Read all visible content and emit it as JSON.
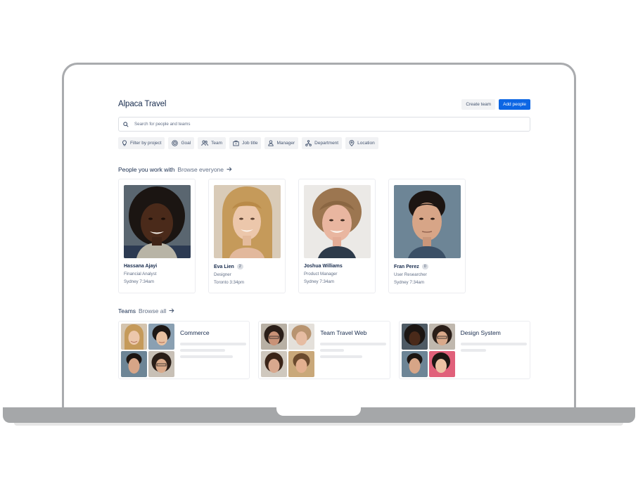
{
  "app": {
    "title": "Alpaca Travel",
    "create_team_label": "Create team",
    "add_people_label": "Add people"
  },
  "search": {
    "placeholder": "Search for people and teams"
  },
  "filters": [
    {
      "label": "Filter by project",
      "icon": "lightbulb-icon"
    },
    {
      "label": "Goal",
      "icon": "target-icon"
    },
    {
      "label": "Team",
      "icon": "people-icon"
    },
    {
      "label": "Job title",
      "icon": "briefcase-icon"
    },
    {
      "label": "Manager",
      "icon": "person-icon"
    },
    {
      "label": "Department",
      "icon": "hierarchy-icon"
    },
    {
      "label": "Location",
      "icon": "location-pin-icon"
    }
  ],
  "people_section": {
    "title": "People you work with",
    "link": "Browse everyone"
  },
  "people": [
    {
      "name": "Hassana Ajayi",
      "role": "Financial Analyst",
      "city": "Sydney",
      "time": "7:34am",
      "badge": ""
    },
    {
      "name": "Eva Lien",
      "role": "Designer",
      "city": "Toronto",
      "time": "3:34pm",
      "badge": "2"
    },
    {
      "name": "Joshua Williams",
      "role": "Product Manager",
      "city": "Sydney",
      "time": "7:34am",
      "badge": ""
    },
    {
      "name": "Fran Perez",
      "role": "User Researcher",
      "city": "Sydney",
      "time": "7:34am",
      "badge": "0"
    }
  ],
  "teams_section": {
    "title": "Teams",
    "link": "Browse all"
  },
  "teams": [
    {
      "name": "Commerce"
    },
    {
      "name": "Team Travel Web"
    },
    {
      "name": "Design System"
    }
  ],
  "colors": {
    "primary": "#0c66e4",
    "text": "#172b4d",
    "subtle": "#626f86",
    "chip_bg": "#f1f2f4"
  }
}
